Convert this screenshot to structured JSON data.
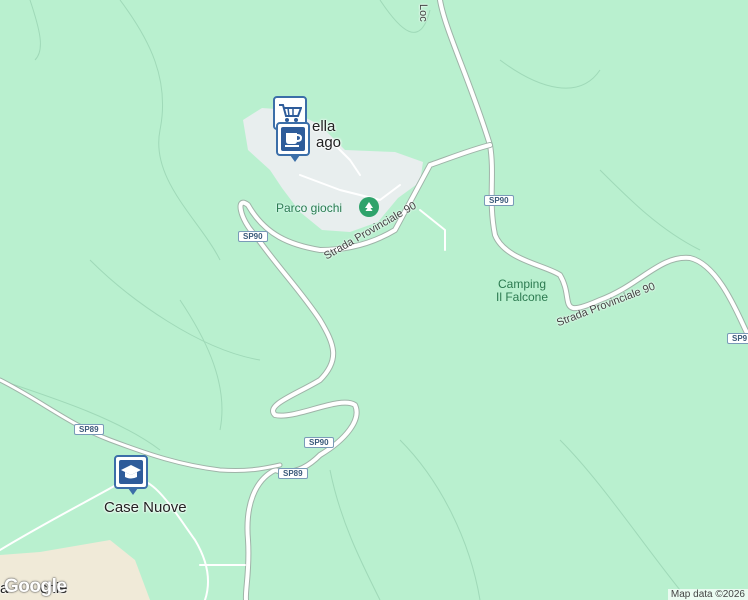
{
  "map": {
    "places": {
      "village_line1": "ella",
      "village_line2": "ago",
      "case_nuove": "Case Nuove",
      "bottom_left_fragment": "a",
      "bottom_left_fragment2": "chie"
    },
    "pois": {
      "park_label": "Parco giochi",
      "camping_line1": "Camping",
      "camping_line2": "Il Falcone",
      "top_fragment": "Loc"
    },
    "roads": {
      "sp90_name_a": "Strada Provinciale 90",
      "sp90_name_b": "Strada Provinciale 90",
      "shield_sp90": "SP90",
      "shield_sp89": "SP89",
      "shield_sp90_edge": "SP9"
    },
    "icons": {
      "shopping": "shopping-cart-icon",
      "cafe": "coffee-cup-icon",
      "school": "graduation-cap-icon",
      "park": "tree-icon"
    },
    "colors": {
      "land": "#b9f0cf",
      "urban": "#e8eeee",
      "road": "#ffffff",
      "pin": "#2e5c9a"
    }
  },
  "attribution": "Map data ©2026",
  "logo": "Google"
}
